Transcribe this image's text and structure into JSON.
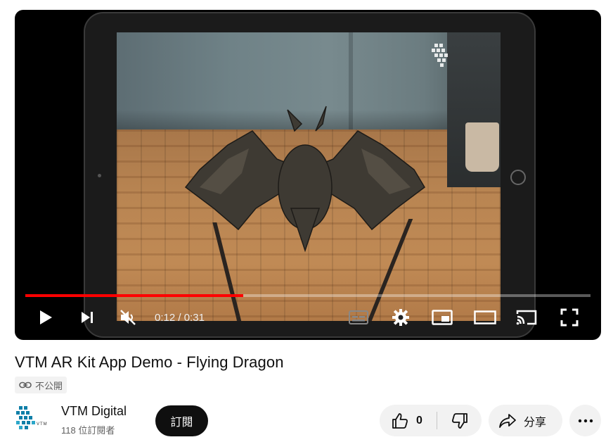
{
  "player": {
    "progress_fraction": 0.385,
    "time_current": "0:12",
    "time_sep": " / ",
    "time_total": "0:31",
    "accent_color": "#ff0000",
    "icons": [
      "play-icon",
      "next-icon",
      "muted-volume-icon",
      "subtitles-icon",
      "settings-gear-icon",
      "miniplayer-icon",
      "theater-mode-icon",
      "cast-icon",
      "fullscreen-icon"
    ]
  },
  "video": {
    "title": "VTM AR Kit App Demo - Flying Dragon",
    "visibility_label": "不公開",
    "visibility_icon": "link-icon"
  },
  "channel": {
    "name": "VTM Digital",
    "subscribers": "118 位訂閱者",
    "subscribe_label": "訂閱"
  },
  "actions": {
    "like_count": "0",
    "like_icon": "thumbs-up-icon",
    "dislike_icon": "thumbs-down-icon",
    "share_label": "分享",
    "share_icon": "share-arrow-icon",
    "more_icon": "more-dots-icon"
  }
}
